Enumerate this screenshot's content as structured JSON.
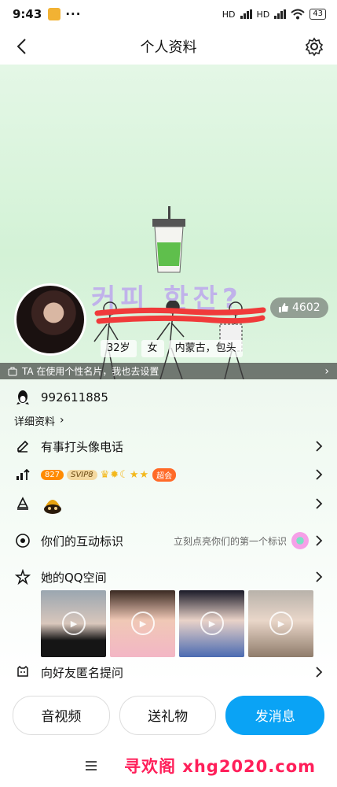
{
  "status": {
    "time": "9:43",
    "net1": "HD",
    "net2": "HD",
    "battery": "43"
  },
  "header": {
    "title": "个人资料"
  },
  "cover": {
    "likes": "4602",
    "tags": [
      "32岁",
      "女",
      "内蒙古，包头"
    ],
    "banner": "TA 在使用个性名片，我也去设置"
  },
  "profile": {
    "qq_number": "992611885",
    "details_label": "详细资料",
    "call_label": "有事打头像电话",
    "level_badge": "827",
    "svip_badge": "SVIP8",
    "ad_badge": "超会",
    "interaction_label": "你们的互动标识",
    "interaction_hint": "立刻点亮你们的第一个标识",
    "qzone_label": "她的QQ空间",
    "ask_label": "向好友匿名提问"
  },
  "actions": {
    "av": "音视频",
    "gift": "送礼物",
    "message": "发消息"
  },
  "watermark": "寻欢阁 xhg2020.com",
  "colors": {
    "accent": "#0aa3f5",
    "cover_bg": "#d6f2d9",
    "watermark": "#ff1f5a"
  }
}
